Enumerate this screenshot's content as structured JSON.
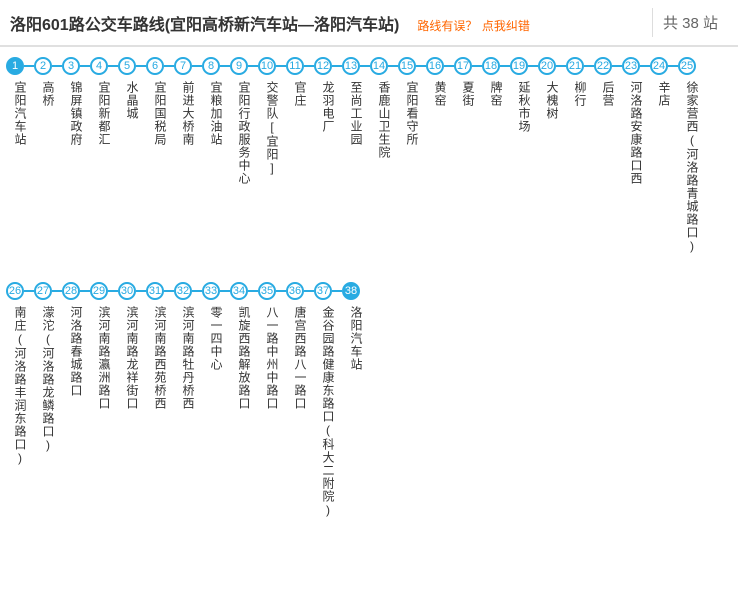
{
  "header": {
    "title": "洛阳601路公交车路线(宜阳高桥新汽车站—洛阳汽车站)",
    "error_prompt": "路线有误？",
    "error_link": "点我纠错",
    "count_prefix": "共 ",
    "count_value": "38",
    "count_suffix": " 站"
  },
  "rows": [
    {
      "stops": [
        {
          "n": 1,
          "name": "宜阳汽车站",
          "solid": true
        },
        {
          "n": 2,
          "name": "高桥"
        },
        {
          "n": 3,
          "name": "锦屏镇政府"
        },
        {
          "n": 4,
          "name": "宜阳新都汇"
        },
        {
          "n": 5,
          "name": "水晶城"
        },
        {
          "n": 6,
          "name": "宜阳国税局"
        },
        {
          "n": 7,
          "name": "前进大桥南"
        },
        {
          "n": 8,
          "name": "宜粮加油站"
        },
        {
          "n": 9,
          "name": "宜阳行政服务中心"
        },
        {
          "n": 10,
          "name": "交警队[宜阳]"
        },
        {
          "n": 11,
          "name": "官庄"
        },
        {
          "n": 12,
          "name": "龙羽电厂"
        },
        {
          "n": 13,
          "name": "至尚工业园"
        },
        {
          "n": 14,
          "name": "香鹿山卫生院"
        },
        {
          "n": 15,
          "name": "宜阳看守所"
        },
        {
          "n": 16,
          "name": "黄窑"
        },
        {
          "n": 17,
          "name": "夏街"
        },
        {
          "n": 18,
          "name": "牌窑"
        },
        {
          "n": 19,
          "name": "延秋市场"
        },
        {
          "n": 20,
          "name": "大槐树"
        },
        {
          "n": 21,
          "name": "柳行"
        },
        {
          "n": 22,
          "name": "后营"
        },
        {
          "n": 23,
          "name": "河洛路安康路口西"
        },
        {
          "n": 24,
          "name": "辛店"
        },
        {
          "n": 25,
          "name": "徐家营西(河洛路青城路口)"
        }
      ]
    },
    {
      "stops": [
        {
          "n": 26,
          "name": "南庄(河洛路丰润东路口)"
        },
        {
          "n": 27,
          "name": "濛沱(河洛路龙鳞路口)"
        },
        {
          "n": 28,
          "name": "河洛路春城路口"
        },
        {
          "n": 29,
          "name": "滨河南路瀛洲路口"
        },
        {
          "n": 30,
          "name": "滨河南路龙祥街口"
        },
        {
          "n": 31,
          "name": "滨河南路西苑桥西"
        },
        {
          "n": 32,
          "name": "滨河南路牡丹桥西"
        },
        {
          "n": 33,
          "name": "零一四中心"
        },
        {
          "n": 34,
          "name": "凯旋西路解放路口"
        },
        {
          "n": 35,
          "name": "八一路中州中路口"
        },
        {
          "n": 36,
          "name": "唐宫西路八一路口"
        },
        {
          "n": 37,
          "name": "金谷园路健康东路口(科大二附院)"
        },
        {
          "n": 38,
          "name": "洛阳汽车站",
          "solid": true
        }
      ]
    }
  ]
}
